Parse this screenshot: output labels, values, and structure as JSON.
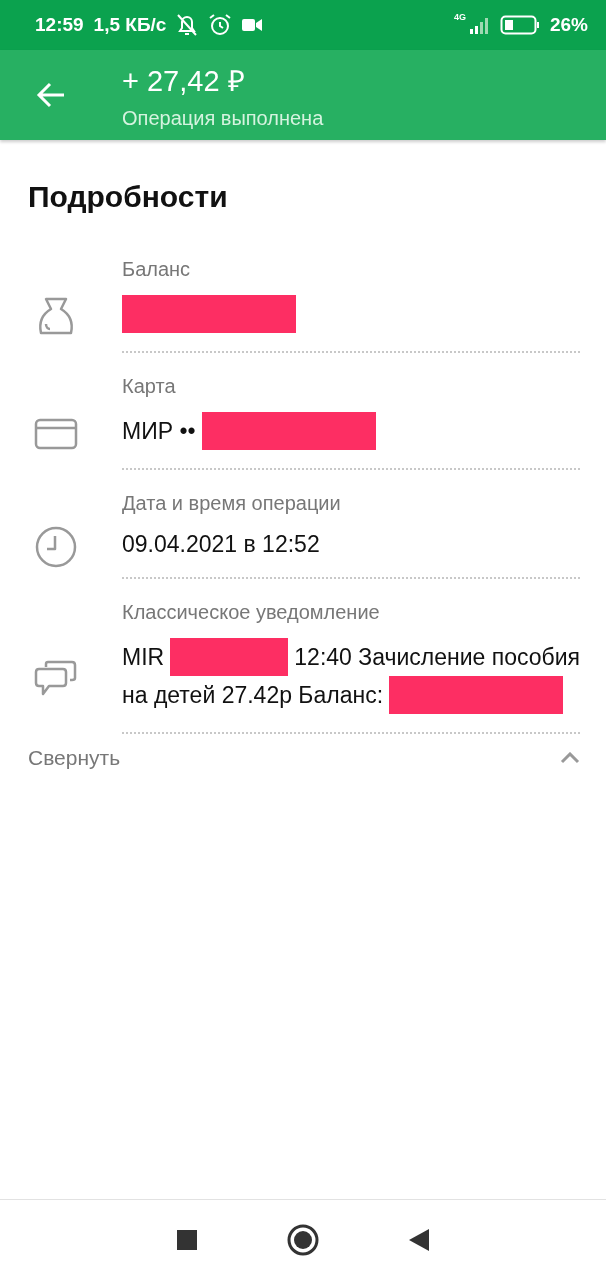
{
  "status_bar": {
    "time": "12:59",
    "speed": "1,5 КБ/с",
    "network": "4G",
    "battery": "26%"
  },
  "header": {
    "amount": "+ 27,42 ₽",
    "status": "Операция выполнена"
  },
  "section_title": "Подробности",
  "details": [
    {
      "kind": "balance",
      "label": "Баланс",
      "lines": [
        [
          {
            "kind": "redaction"
          }
        ]
      ]
    },
    {
      "kind": "card",
      "label": "Карта",
      "lines": [
        [
          {
            "kind": "text",
            "text": "МИР ••"
          },
          {
            "kind": "redaction"
          }
        ]
      ]
    },
    {
      "kind": "datetime",
      "label": "Дата и время операции",
      "lines": [
        [
          {
            "kind": "text",
            "text": "09.04.2021 в 12:52"
          }
        ]
      ]
    },
    {
      "kind": "message",
      "label": "Классическое уведомление",
      "lines": [
        [
          {
            "kind": "text",
            "text": "MIR"
          },
          {
            "kind": "redaction"
          },
          {
            "kind": "text",
            "text": "12:40 Зачисление пособия"
          }
        ],
        [
          {
            "kind": "text",
            "text": "на детей 27.42р Баланс:"
          },
          {
            "kind": "redaction"
          }
        ]
      ]
    }
  ],
  "collapse": {
    "label": "Свернуть",
    "expanded": true
  }
}
